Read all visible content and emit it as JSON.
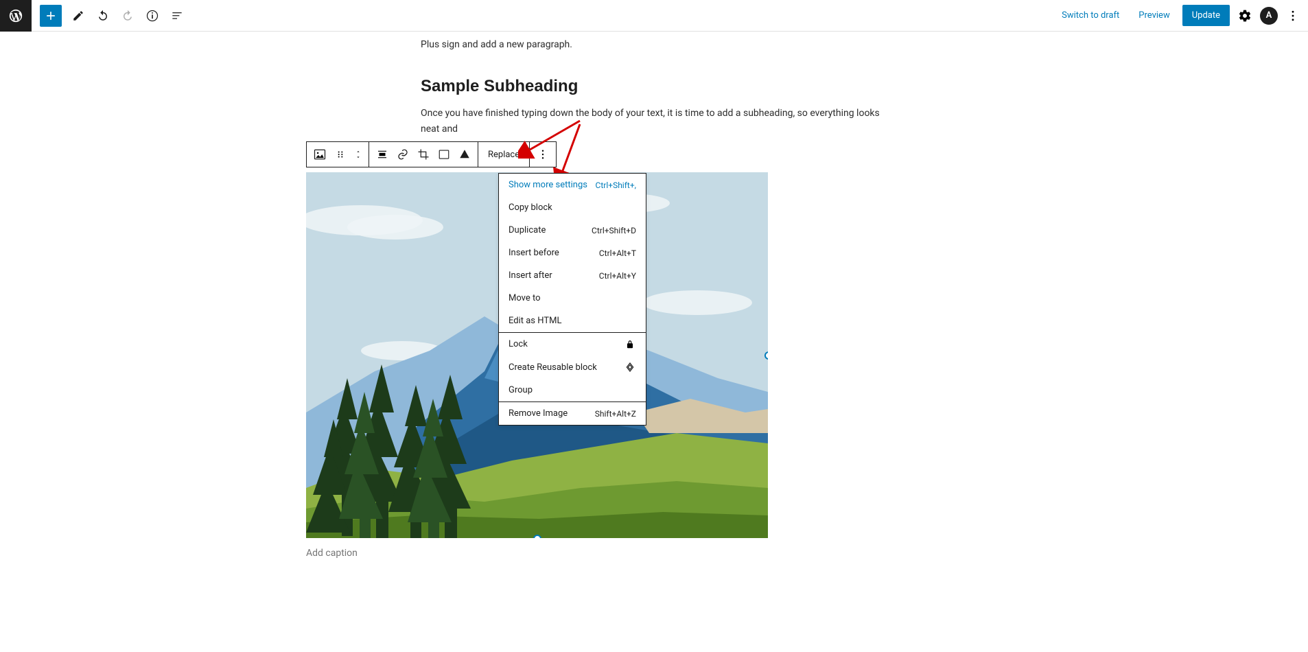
{
  "topbar": {
    "switch_label": "Switch to draft",
    "preview_label": "Preview",
    "update_label": "Update",
    "avatar_initial": "A"
  },
  "content": {
    "para_top": "Plus sign and add a new paragraph.",
    "subheading": "Sample Subheading",
    "para_body": "Once you have finished typing down the body of your text, it is time to add a subheading, so everything looks neat and",
    "caption_placeholder": "Add caption"
  },
  "block_toolbar": {
    "replace_label": "Replace"
  },
  "menu": {
    "show_more": {
      "label": "Show more settings",
      "shortcut": "Ctrl+Shift+,"
    },
    "copy": {
      "label": "Copy block"
    },
    "duplicate": {
      "label": "Duplicate",
      "shortcut": "Ctrl+Shift+D"
    },
    "insert_before": {
      "label": "Insert before",
      "shortcut": "Ctrl+Alt+T"
    },
    "insert_after": {
      "label": "Insert after",
      "shortcut": "Ctrl+Alt+Y"
    },
    "move_to": {
      "label": "Move to"
    },
    "edit_html": {
      "label": "Edit as HTML"
    },
    "lock": {
      "label": "Lock"
    },
    "reusable": {
      "label": "Create Reusable block"
    },
    "group": {
      "label": "Group"
    },
    "remove": {
      "label": "Remove Image",
      "shortcut": "Shift+Alt+Z"
    }
  }
}
